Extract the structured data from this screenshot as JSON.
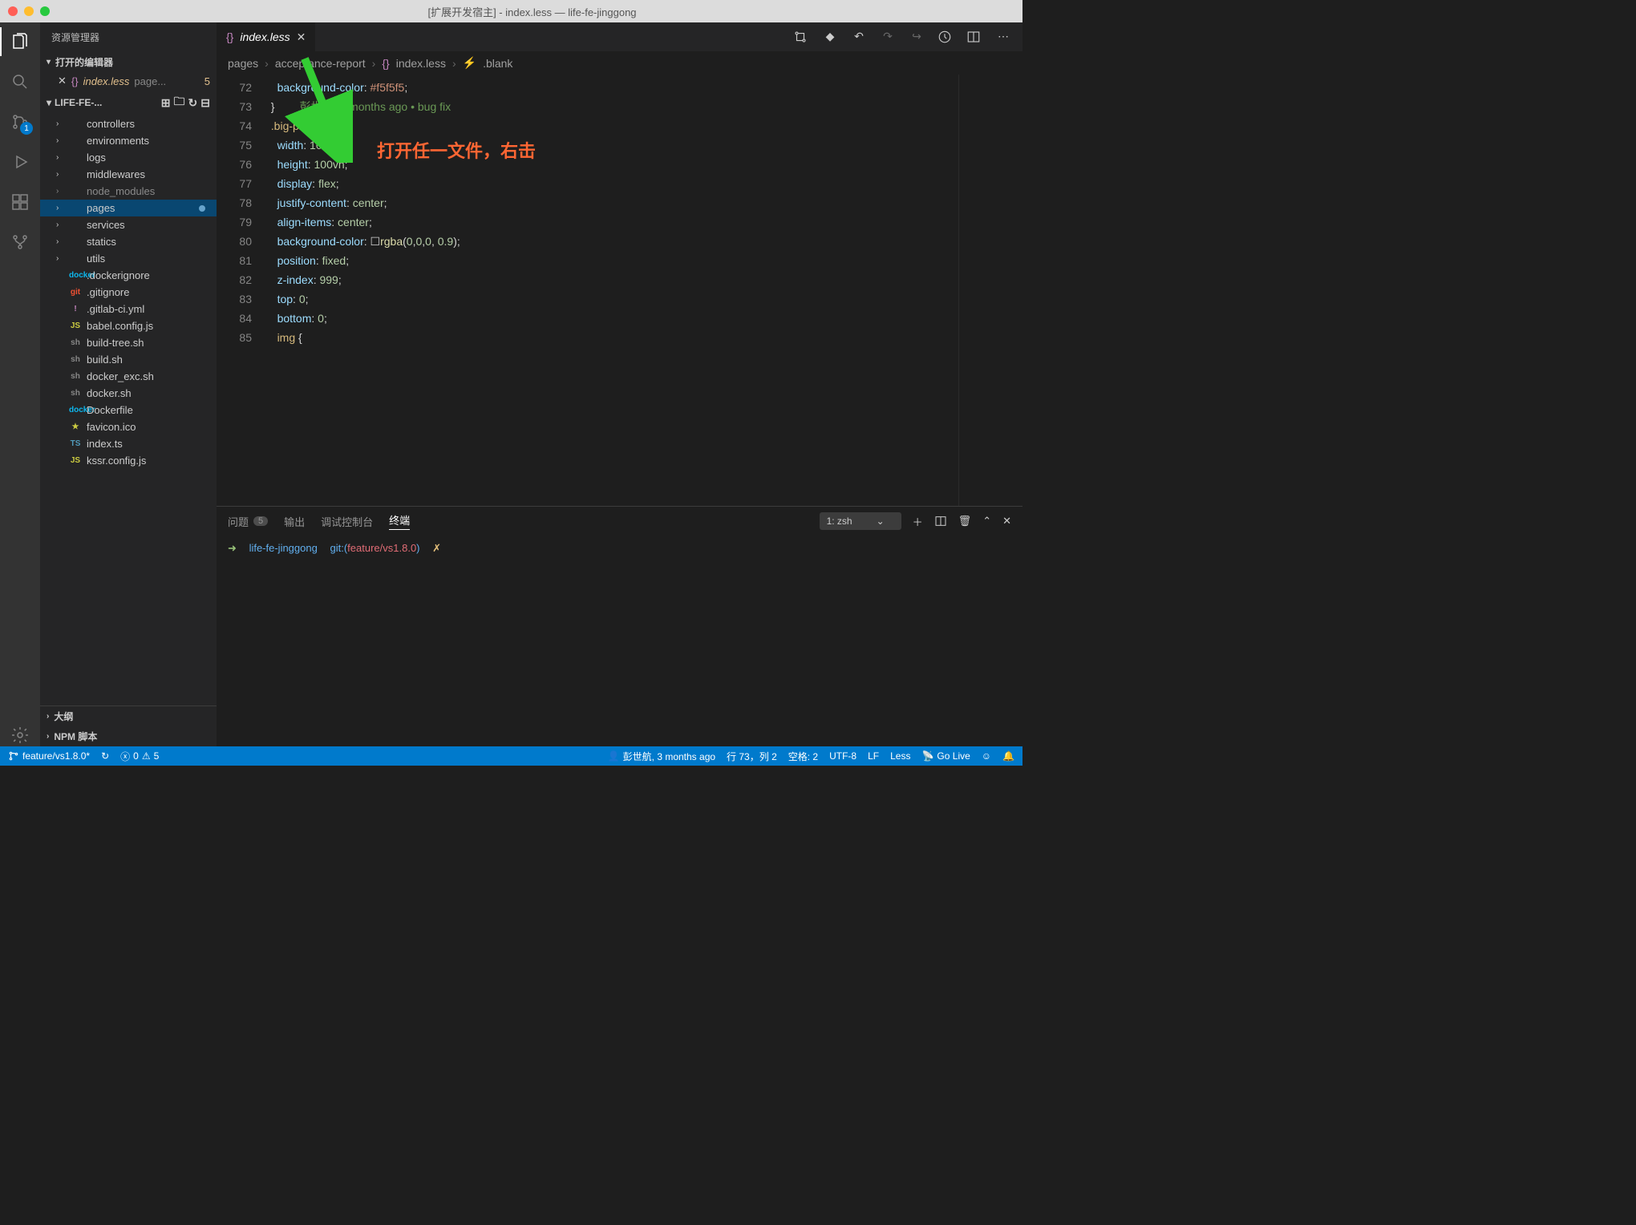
{
  "titlebar": "[扩展开发宿主] - index.less — life-fe-jinggong",
  "sidebar": {
    "title": "资源管理器",
    "open_editors_label": "打开的编辑器",
    "open_file": {
      "name": "index.less",
      "path": "page...",
      "count": "5"
    },
    "project_label": "LIFE-FE-...",
    "tree": [
      {
        "type": "folder",
        "name": "controllers"
      },
      {
        "type": "folder",
        "name": "environments"
      },
      {
        "type": "folder",
        "name": "logs"
      },
      {
        "type": "folder",
        "name": "middlewares"
      },
      {
        "type": "folder",
        "name": "node_modules",
        "muted": true
      },
      {
        "type": "folder",
        "name": "pages",
        "selected": true,
        "modified": true
      },
      {
        "type": "folder",
        "name": "services"
      },
      {
        "type": "folder",
        "name": "statics"
      },
      {
        "type": "folder",
        "name": "utils"
      },
      {
        "type": "file",
        "name": ".dockerignore",
        "icon": "docker",
        "color": "#0db7ed"
      },
      {
        "type": "file",
        "name": ".gitignore",
        "icon": "git",
        "color": "#f05133"
      },
      {
        "type": "file",
        "name": ".gitlab-ci.yml",
        "icon": "!",
        "color": "#c586c0"
      },
      {
        "type": "file",
        "name": "babel.config.js",
        "icon": "JS",
        "color": "#cbcb41"
      },
      {
        "type": "file",
        "name": "build-tree.sh",
        "icon": "sh",
        "color": "#888"
      },
      {
        "type": "file",
        "name": "build.sh",
        "icon": "sh",
        "color": "#888"
      },
      {
        "type": "file",
        "name": "docker_exc.sh",
        "icon": "sh",
        "color": "#888"
      },
      {
        "type": "file",
        "name": "docker.sh",
        "icon": "sh",
        "color": "#888"
      },
      {
        "type": "file",
        "name": "Dockerfile",
        "icon": "docker",
        "color": "#0db7ed"
      },
      {
        "type": "file",
        "name": "favicon.ico",
        "icon": "★",
        "color": "#cbcb41"
      },
      {
        "type": "file",
        "name": "index.ts",
        "icon": "TS",
        "color": "#519aba"
      },
      {
        "type": "file",
        "name": "kssr.config.js",
        "icon": "JS",
        "color": "#cbcb41"
      }
    ],
    "outline_label": "大纲",
    "npm_label": "NPM 脚本"
  },
  "scm_badge": "1",
  "tab": {
    "name": "index.less"
  },
  "breadcrumb": {
    "p1": "pages",
    "p2": "acceptance-report",
    "p3": "index.less",
    "p4": ".blank"
  },
  "code": {
    "start": 72,
    "lines": [
      {
        "n": 72,
        "html": "    <span class='prop'>background-color</span><span class='punct'>:</span> <span class='val'>#f5f5f5</span><span class='punct'>;</span>"
      },
      {
        "n": 73,
        "html": "  <span class='punct'>}</span>        <span class='comment'>彭世航, 3 months ago • bug fix</span>"
      },
      {
        "n": 74,
        "html": "  <span class='sel'>.big-pic</span> <span class='punct'>{</span>"
      },
      {
        "n": 75,
        "html": "    <span class='prop'>width</span><span class='punct'>:</span> <span class='num'>100vw</span><span class='punct'>;</span>"
      },
      {
        "n": 76,
        "html": "    <span class='prop'>height</span><span class='punct'>:</span> <span class='num'>100vh</span><span class='punct'>;</span>"
      },
      {
        "n": 77,
        "html": "    <span class='prop'>display</span><span class='punct'>:</span> <span class='num'>flex</span><span class='punct'>;</span>"
      },
      {
        "n": 78,
        "html": "    <span class='prop'>justify-content</span><span class='punct'>:</span> <span class='num'>center</span><span class='punct'>;</span>"
      },
      {
        "n": 79,
        "html": "    <span class='prop'>align-items</span><span class='punct'>:</span> <span class='num'>center</span><span class='punct'>;</span>"
      },
      {
        "n": 80,
        "html": "    <span class='prop'>background-color</span><span class='punct'>:</span> <span class='punct'>☐</span><span class='func'>rgba</span><span class='punct'>(</span><span class='num'>0</span><span class='punct'>,</span><span class='num'>0</span><span class='punct'>,</span><span class='num'>0</span><span class='punct'>,</span> <span class='num'>0.9</span><span class='punct'>)</span><span class='punct'>;</span>"
      },
      {
        "n": 81,
        "html": "    <span class='prop'>position</span><span class='punct'>:</span> <span class='num'>fixed</span><span class='punct'>;</span>"
      },
      {
        "n": 82,
        "html": "    <span class='prop'>z-index</span><span class='punct'>:</span> <span class='num'>999</span><span class='punct'>;</span>"
      },
      {
        "n": 83,
        "html": "    <span class='prop'>top</span><span class='punct'>:</span> <span class='num'>0</span><span class='punct'>;</span>"
      },
      {
        "n": 84,
        "html": "    <span class='prop'>bottom</span><span class='punct'>:</span> <span class='num'>0</span><span class='punct'>;</span>"
      },
      {
        "n": 85,
        "html": "    <span class='sel'>img</span> <span class='punct'>{</span>"
      }
    ]
  },
  "annotation_text": "打开任一文件，右击",
  "panel": {
    "tabs": {
      "problems": "问题",
      "problems_count": "5",
      "output": "输出",
      "debug": "调试控制台",
      "terminal": "终端"
    },
    "term_select": "1: zsh",
    "prompt": {
      "arrow": "➜",
      "path": "life-fe-jinggong",
      "git": "git:(",
      "branch": "feature/vs1.8.0",
      "close": ")",
      "dirty": "✗"
    }
  },
  "status": {
    "branch": "feature/vs1.8.0*",
    "errors": "0",
    "warnings": "5",
    "blame": "彭世航, 3 months ago",
    "pos": "行 73，列 2",
    "spaces": "空格: 2",
    "encoding": "UTF-8",
    "eol": "LF",
    "lang": "Less",
    "golive": "Go Live"
  }
}
